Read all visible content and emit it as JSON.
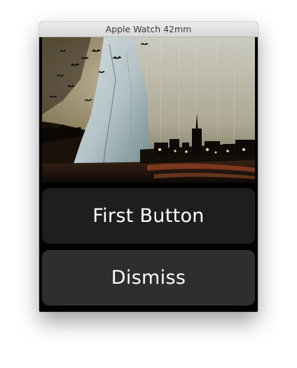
{
  "window": {
    "title": "Apple Watch 42mm"
  },
  "screen": {
    "image_icon": "dark-stormy-landscape-image",
    "buttons": [
      {
        "label": "First Button"
      },
      {
        "label": "Dismiss"
      }
    ]
  }
}
